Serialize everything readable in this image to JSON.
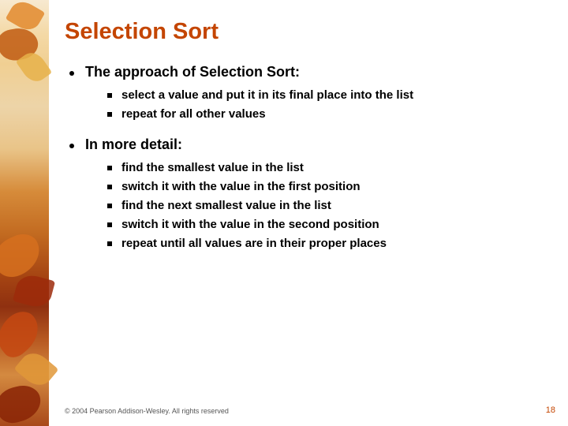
{
  "title": "Selection Sort",
  "bullets": [
    {
      "text": "The approach of Selection Sort:",
      "sub": [
        "select a value and put it in its final place into the list",
        "repeat for all other values"
      ]
    },
    {
      "text": "In more detail:",
      "sub": [
        "find the smallest value in the list",
        "switch it with the value in the first position",
        "find the next smallest value in the list",
        "switch it with the value in the second position",
        "repeat until all values are in their proper places"
      ]
    }
  ],
  "footer": "© 2004 Pearson Addison-Wesley. All rights reserved",
  "page_number": "18"
}
